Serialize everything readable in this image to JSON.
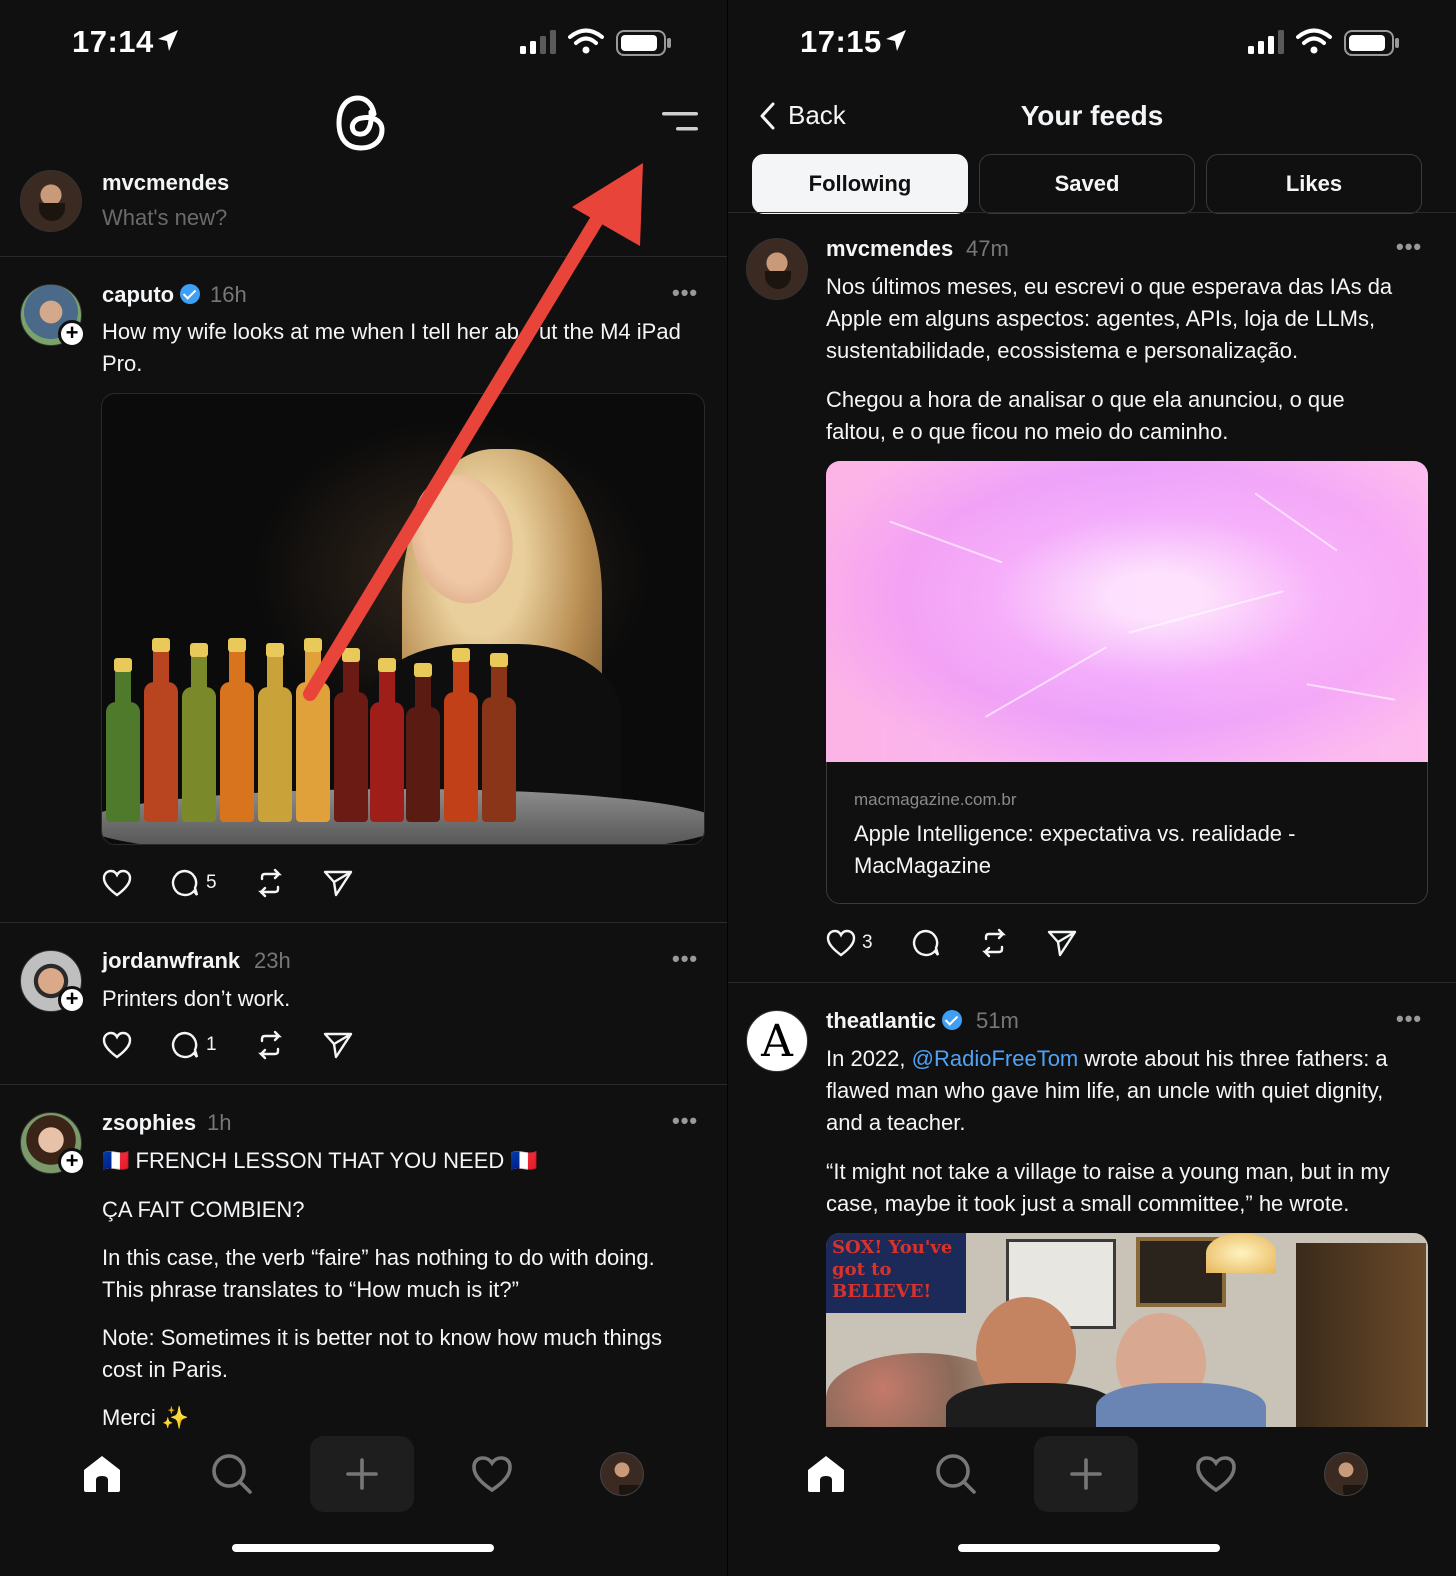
{
  "left": {
    "status": {
      "time": "17:14"
    },
    "compose": {
      "username": "mvcmendes",
      "placeholder": "What's new?"
    },
    "posts": [
      {
        "username": "caputo",
        "verified": true,
        "time": "16h",
        "text_a": "How my wife looks at me when I tell her ab",
        "text_b": "ut the M4 iPad",
        "text_c": "Pro.",
        "comments": "5"
      },
      {
        "username": "jordanwfrank",
        "time": "23h",
        "text": "Printers don’t work.",
        "comments": "1"
      },
      {
        "username": "zsophies",
        "time": "1h",
        "line1": "🇫🇷 FRENCH LESSON THAT YOU NEED 🇫🇷",
        "line2": "ÇA FAIT COMBIEN?",
        "line3a": "In this case, the verb “faire” has nothing to do with doing.",
        "line3b": "This phrase translates to “How much is it?”",
        "line4a": "Note: Sometimes it is better not to know how much things",
        "line4b": "cost in Paris.",
        "line5": "Merci ✨"
      }
    ]
  },
  "right": {
    "status": {
      "time": "17:15"
    },
    "back_label": "Back",
    "title": "Your feeds",
    "tabs": [
      "Following",
      "Saved",
      "Likes"
    ],
    "posts": [
      {
        "username": "mvcmendes",
        "time": "47m",
        "p1a": "Nos últimos meses, eu escrevi o que esperava das IAs da",
        "p1b": "Apple em alguns aspectos: agentes, APIs, loja de LLMs,",
        "p1c": "sustentabilidade, ecossistema e personalização.",
        "p2a": "Chegou a hora de analisar o que ela anunciou, o que",
        "p2b": "faltou, e o que ficou no meio do caminho.",
        "link_domain": "macmagazine.com.br",
        "link_title_a": "Apple Intelligence: expectativa vs. realidade -",
        "link_title_b": "MacMagazine",
        "likes": "3"
      },
      {
        "username": "theatlantic",
        "verified": true,
        "time": "51m",
        "p1_pre": "In 2022, ",
        "mention": "@RadioFreeTom",
        "p1_post": " wrote about his three fathers: a",
        "p1b": "flawed man who gave him life, an uncle with quiet dignity,",
        "p1c": "and a teacher.",
        "p2a": "“It might not take a village to raise a young man, but in my",
        "p2b": "case, maybe it took just a small committee,” he wrote.",
        "image_text": "SOX! You've got to BELIEVE!"
      }
    ]
  },
  "colors": {
    "background": "#101010",
    "text": "#f3f5f7",
    "muted": "#777777",
    "verified": "#3d9ff5",
    "mention": "#4fa3f7",
    "arrow": "#e8443a"
  },
  "icons": [
    "location-arrow-icon",
    "signal-icon",
    "wifi-icon",
    "battery-icon",
    "threads-logo-icon",
    "menu-icon",
    "heart-icon",
    "comment-icon",
    "repost-icon",
    "share-icon",
    "home-icon",
    "search-icon",
    "plus-icon",
    "activity-heart-icon",
    "profile-avatar-icon",
    "chevron-left-icon",
    "more-icon"
  ]
}
